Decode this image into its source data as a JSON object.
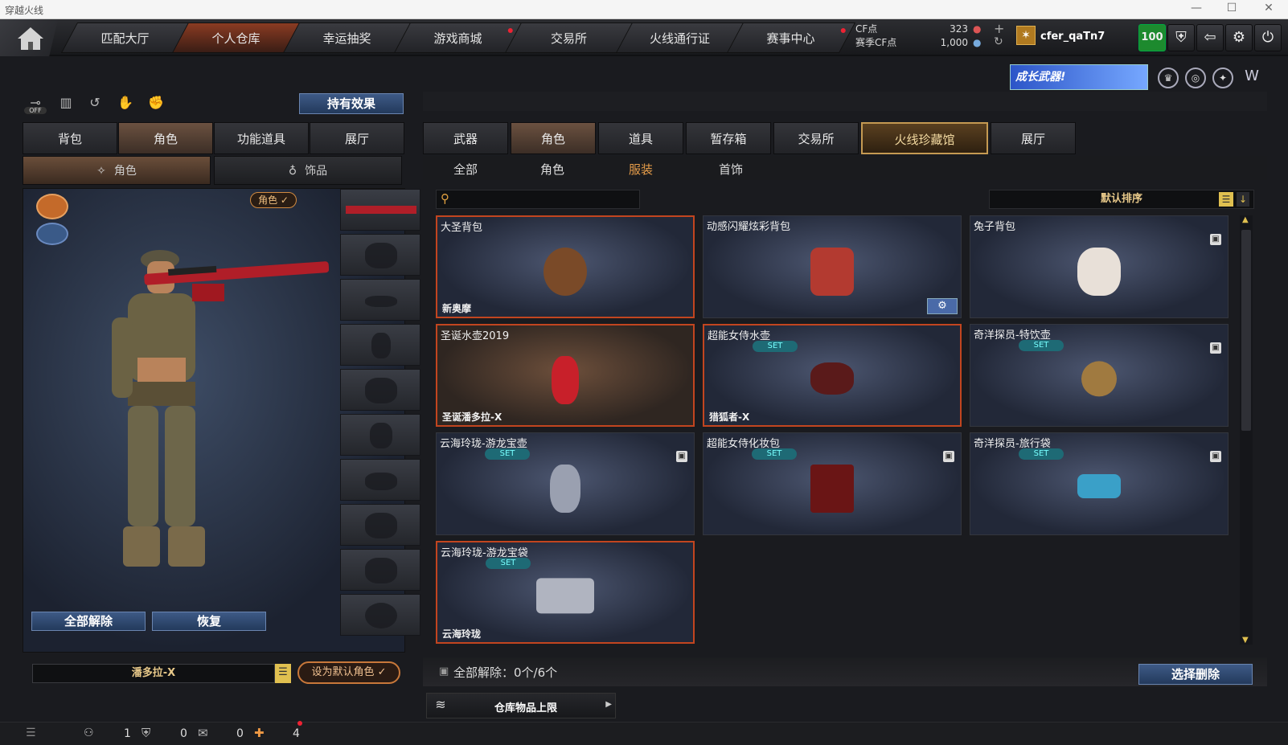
{
  "window": {
    "title": "穿越火线"
  },
  "nav": {
    "tabs": [
      "匹配大厅",
      "个人仓库",
      "幸运抽奖",
      "游戏商城",
      "交易所",
      "火线通行证",
      "赛事中心"
    ],
    "active_tab": "个人仓库",
    "cf_label": "CF点",
    "season_cf_label": "赛季CF点",
    "cf_value": "323",
    "season_cf_value": "1,000",
    "username": "cfer_qaTn7",
    "level_badge": "100"
  },
  "banner": {
    "text": "成长武器!"
  },
  "left": {
    "effect_button": "持有效果",
    "tabs": [
      "背包",
      "角色",
      "功能道具",
      "展厅"
    ],
    "active_tab": "角色",
    "subtabs": [
      "角色",
      "饰品"
    ],
    "role_tag": "角色 ✓",
    "unequip_all": "全部解除",
    "restore": "恢复",
    "character_name": "潘多拉-X",
    "set_default": "设为默认角色 ✓",
    "toggle_off": "OFF"
  },
  "right": {
    "tabs": [
      "武器",
      "角色",
      "道具",
      "暂存箱",
      "交易所",
      "火线珍藏馆",
      "展厅"
    ],
    "active_tab": "角色",
    "subtabs": [
      "全部",
      "角色",
      "服装",
      "首饰"
    ],
    "active_subtab": "服装",
    "search_placeholder": "",
    "sort": "默认排序",
    "items": [
      {
        "name": "大圣背包",
        "sub": "新奥摩",
        "set": "",
        "highlight": true
      },
      {
        "name": "动感闪耀炫彩背包",
        "sub": "",
        "set": "",
        "highlight": false
      },
      {
        "name": "兔子背包",
        "sub": "",
        "set": "",
        "highlight": false
      },
      {
        "name": "圣诞水壶2019",
        "sub": "圣诞潘多拉-X",
        "set": "",
        "highlight": true
      },
      {
        "name": "超能女侍水壶",
        "sub": "猎狐者-X",
        "set": "SET",
        "highlight": true
      },
      {
        "name": "奇洋探员-特饮壶",
        "sub": "",
        "set": "SET",
        "highlight": false
      },
      {
        "name": "云海玲珑-游龙宝壶",
        "sub": "",
        "set": "SET",
        "highlight": false
      },
      {
        "name": "超能女侍化妆包",
        "sub": "",
        "set": "SET",
        "highlight": false
      },
      {
        "name": "奇洋探员-旅行袋",
        "sub": "",
        "set": "SET",
        "highlight": false
      },
      {
        "name": "云海玲珑-游龙宝袋",
        "sub": "云海玲珑",
        "set": "SET",
        "highlight": true
      }
    ],
    "unequip_status": "全部解除：0个/6个",
    "select_delete": "选择删除",
    "warehouse_limit": "仓库物品上限"
  },
  "status": {
    "values": [
      "1",
      "0",
      "0",
      "4"
    ]
  },
  "colors": {
    "accent": "#c2451f",
    "gold": "#c59a52",
    "blue_button": "#3e5a86"
  }
}
